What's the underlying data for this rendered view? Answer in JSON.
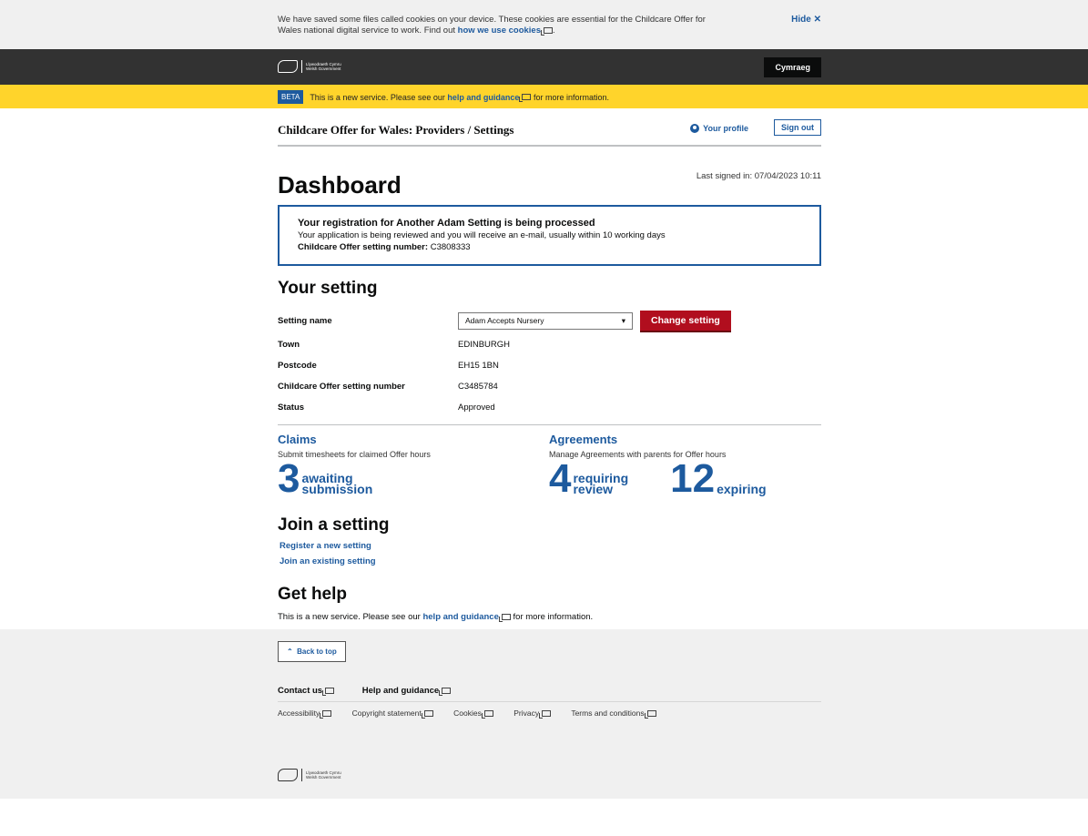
{
  "cookie": {
    "text": "We have saved some files called cookies on your device. These cookies are essential for the Childcare Offer for Wales national digital service to work. Find out ",
    "link": "how we use cookies",
    "hide": "Hide ✕"
  },
  "gov": {
    "logo_line1": "Llywodraeth Cymru",
    "logo_line2": "Welsh Government",
    "language_button": "Cymraeg"
  },
  "beta": {
    "tag": "BETA",
    "text_before": "This is a new service. Please see our ",
    "link": "help and guidance",
    "text_after": " for more information."
  },
  "service": {
    "title": "Childcare Offer for Wales: Providers / Settings",
    "profile_link": "Your profile",
    "sign_out": "Sign out"
  },
  "page": {
    "heading": "Dashboard",
    "last_signed_in": "Last signed in: 07/04/2023 10:11"
  },
  "notice": {
    "title": "Your registration for Another Adam Setting is being processed",
    "body": "Your application is being reviewed and you will receive an e-mail, usually within 10 working days",
    "number_label": "Childcare Offer setting number:",
    "number_value": " C3808333"
  },
  "setting": {
    "heading": "Your setting",
    "name_label": "Setting name",
    "selected": "Adam Accepts Nursery",
    "change_button": "Change setting",
    "details": [
      {
        "label": "Town",
        "value": "EDINBURGH"
      },
      {
        "label": "Postcode",
        "value": "EH15 1BN"
      },
      {
        "label": "Childcare Offer setting number",
        "value": "C3485784"
      },
      {
        "label": "Status",
        "value": "Approved"
      }
    ]
  },
  "claims": {
    "title": "Claims",
    "desc": "Submit timesheets for claimed Offer hours",
    "count": "3",
    "label_line1": "awaiting",
    "label_line2": "submission"
  },
  "agreements": {
    "title": "Agreements",
    "desc": "Manage Agreements with parents for Offer hours",
    "review_count": "4",
    "review_line1": "requiring",
    "review_line2": "review",
    "expiring_count": "12",
    "expiring_label": "expiring"
  },
  "join": {
    "heading": "Join a setting",
    "register_link": "Register a new setting",
    "existing_link": "Join an existing setting"
  },
  "help": {
    "heading": "Get help",
    "text_before": "This is a new service. Please see our ",
    "link": "help and guidance",
    "text_after": " for more information."
  },
  "footer": {
    "back_to_top": "Back to top",
    "primary_links": [
      "Contact us",
      "Help and guidance"
    ],
    "secondary_links": [
      "Accessibility",
      "Copyright statement",
      "Cookies",
      "Privacy",
      "Terms and conditions"
    ],
    "logo_line1": "Llywodraeth Cymru",
    "logo_line2": "Welsh Government"
  }
}
